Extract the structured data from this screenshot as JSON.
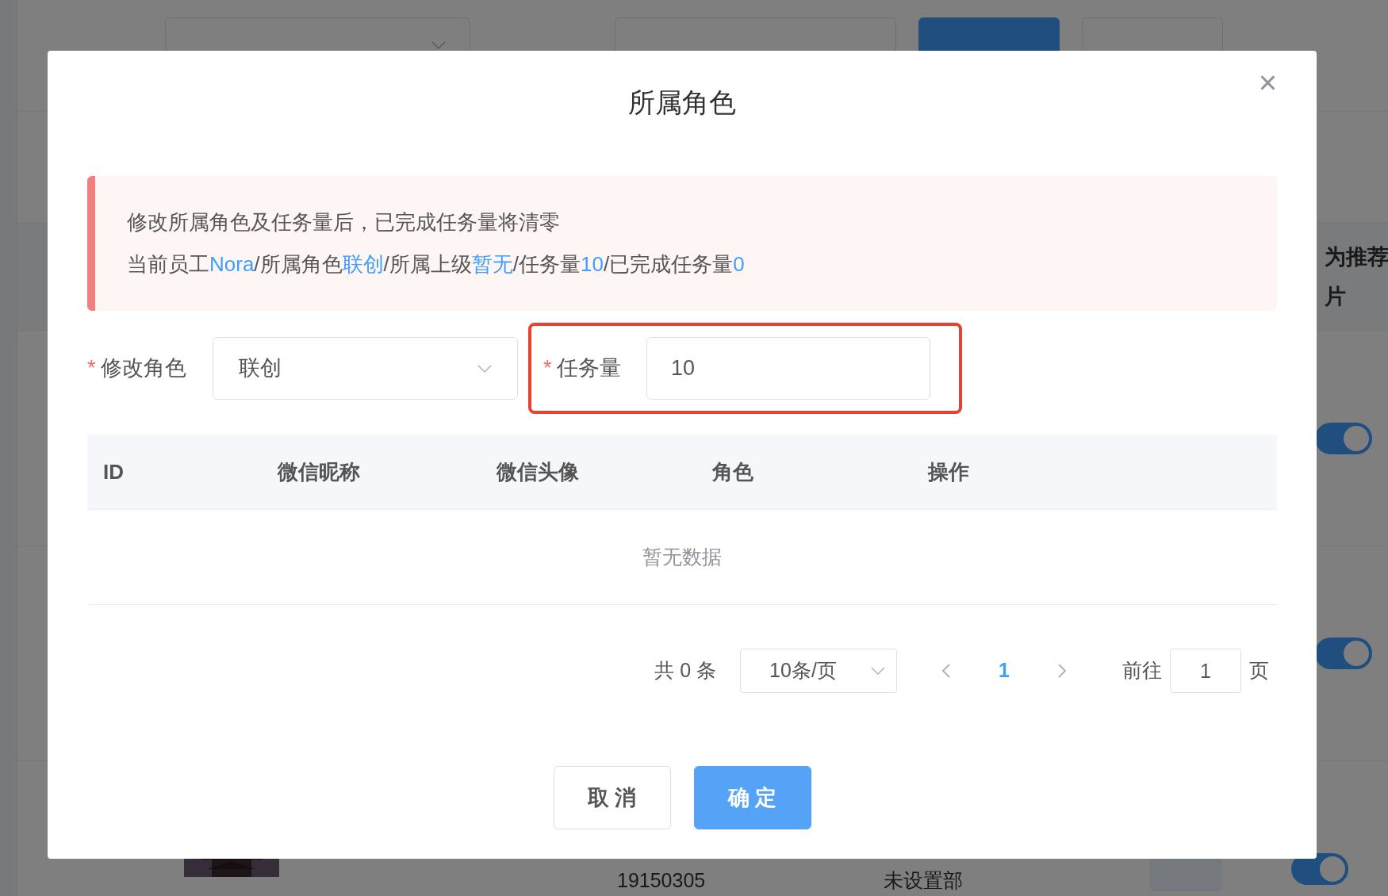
{
  "background": {
    "header_text": [
      "为推荐",
      "片"
    ],
    "rows": [
      {
        "switch_on": true
      },
      {
        "switch_on": true
      },
      {
        "switch_on": true,
        "phone": "19150305",
        "department": "未设置部"
      }
    ]
  },
  "dialog": {
    "title": "所属角色",
    "close": "×",
    "alert": {
      "line_1": "修改所属角色及任务量后，已完成任务量将清零",
      "line_2": [
        {
          "text": "当前员工",
          "highlight": false
        },
        {
          "text": "Nora",
          "highlight": true
        },
        {
          "text": "/所属角色",
          "highlight": false
        },
        {
          "text": "联创",
          "highlight": true
        },
        {
          "text": "/所属上级",
          "highlight": false
        },
        {
          "text": "暂无",
          "highlight": true
        },
        {
          "text": "/任务量",
          "highlight": false
        },
        {
          "text": "10",
          "highlight": true
        },
        {
          "text": "/已完成任务量",
          "highlight": false
        },
        {
          "text": "0",
          "highlight": true
        }
      ]
    },
    "form": {
      "role": {
        "required_mark": "*",
        "label": "修改角色",
        "value": "联创"
      },
      "quota": {
        "required_mark": "*",
        "label": "任务量",
        "value": "10",
        "highlighted": true
      }
    },
    "table": {
      "columns": [
        "ID",
        "微信昵称",
        "微信头像",
        "角色",
        "操作"
      ],
      "empty_text": "暂无数据"
    },
    "pagination": {
      "total": "共 0 条",
      "page_size": "10条/页",
      "pages": [
        {
          "label": "1",
          "selected": true
        }
      ],
      "goto_label": "前往",
      "goto_value": "1",
      "goto_suffix": "页"
    },
    "buttons": [
      {
        "label": "取 消",
        "kind": "secondary"
      },
      {
        "label": "确 定",
        "kind": "primary"
      }
    ]
  }
}
